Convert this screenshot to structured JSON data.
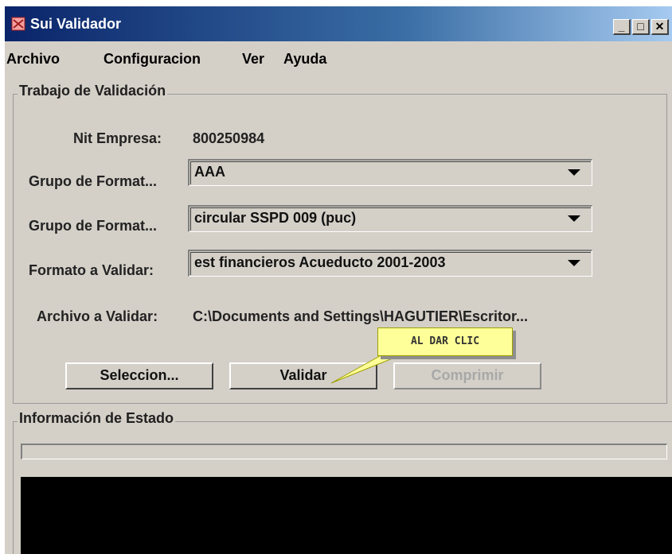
{
  "window": {
    "title": "Sui Validador"
  },
  "menu": {
    "items": [
      "Archivo",
      "Configuracion",
      "Ver",
      "Ayuda"
    ]
  },
  "trabajo": {
    "title": "Trabajo de Validación",
    "nit_label": "Nit Empresa:",
    "nit_value": "800250984",
    "grupo1_label": "Grupo de Format...",
    "grupo1_value": "AAA",
    "grupo2_label": "Grupo de Format...",
    "grupo2_value": "circular SSPD 009 (puc)",
    "formato_label": "Formato a Validar:",
    "formato_value": "est financieros Acueducto 2001-2003",
    "archivo_label": "Archivo a Validar:",
    "archivo_value": "C:\\Documents and Settings\\HAGUTIER\\Escritor...",
    "buttons": {
      "seleccion": "Seleccion...",
      "validar": "Validar",
      "comprimir": "Comprimir"
    }
  },
  "estado": {
    "title": "Información de Estado",
    "progress": 0
  },
  "callout": {
    "text": "AL DAR CLIC"
  },
  "colors": {
    "titlebar_start": "#0a246a",
    "titlebar_end": "#a6caf0",
    "callout_bg": "#ffff99",
    "console_bg": "#000000"
  }
}
